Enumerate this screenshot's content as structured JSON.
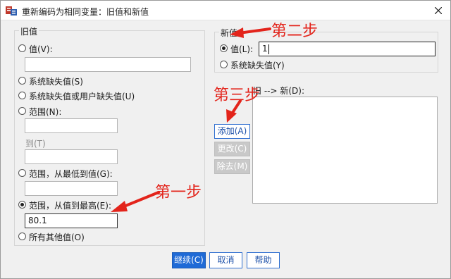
{
  "window": {
    "title": "重新编码为相同变量：旧值和新值"
  },
  "old_value": {
    "group_label": "旧值",
    "value_label": "值(V):",
    "value_input": "",
    "system_missing_label": "系统缺失值(S)",
    "system_or_user_missing_label": "系统缺失值或用户缺失值(U)",
    "range_label": "范围(N):",
    "range_from_input": "",
    "to_label": "到(T)",
    "range_to_input": "",
    "lowest_through_label": "范围，从最低到值(G):",
    "lowest_through_input": "",
    "value_through_highest_label": "范围，从值到最高(E):",
    "value_through_highest_input": "80.1",
    "all_other_label": "所有其他值(O)",
    "selected_option": "value_through_highest"
  },
  "new_value": {
    "group_label": "新值",
    "value_label": "值(L):",
    "value_input": "1",
    "system_missing_label": "系统缺失值(Y)",
    "selected_option": "value"
  },
  "mapping": {
    "label": "旧 --> 新(D):",
    "add_label": "添加(A)",
    "change_label": "更改(C)",
    "remove_label": "除去(M)"
  },
  "footer": {
    "continue_label": "继续(C)",
    "cancel_label": "取消",
    "help_label": "帮助"
  },
  "annotations": {
    "step1": "第一步",
    "step2": "第二步",
    "step3": "第三步",
    "color": "#e3241b"
  },
  "icons": {
    "app": "spss-recode-icon",
    "close": "close-icon"
  }
}
